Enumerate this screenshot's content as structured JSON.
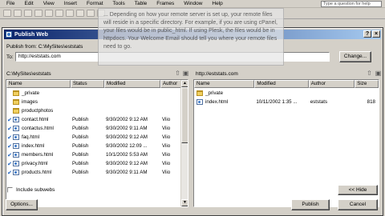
{
  "app": {
    "menu": [
      "File",
      "Edit",
      "View",
      "Insert",
      "Format",
      "Tools",
      "Table",
      "Frames",
      "Window",
      "Help"
    ],
    "help_placeholder": "Type a question for help"
  },
  "dialog": {
    "title": "Publish Web",
    "publish_from_label": "Publish from: C:\\MySites\\eststats",
    "to_label": "To:",
    "destination": "http://eststats.com",
    "change_button": "Change...",
    "local_path": "C:\\MySites\\eststats",
    "remote_path": "http://eststats.com",
    "local_columns": [
      "Name",
      "Status",
      "Modified",
      "Author"
    ],
    "remote_columns": [
      "Name",
      "Modified",
      "Author",
      "Size"
    ],
    "local_files": [
      {
        "name": "_private",
        "type": "folder",
        "checked": false,
        "status": "",
        "modified": "",
        "author": ""
      },
      {
        "name": "images",
        "type": "folder",
        "checked": false,
        "status": "",
        "modified": "",
        "author": ""
      },
      {
        "name": "productphotos",
        "type": "folder",
        "checked": false,
        "status": "",
        "modified": "",
        "author": ""
      },
      {
        "name": "contact.html",
        "type": "file",
        "checked": true,
        "status": "Publish",
        "modified": "9/30/2002 9:12 AM",
        "author": "Viio"
      },
      {
        "name": "contactus.html",
        "type": "file",
        "checked": true,
        "status": "Publish",
        "modified": "9/30/2002 9:11 AM",
        "author": "Viio"
      },
      {
        "name": "faq.html",
        "type": "file",
        "checked": true,
        "status": "Publish",
        "modified": "9/30/2002 9:12 AM",
        "author": "Viio"
      },
      {
        "name": "index.html",
        "type": "file",
        "checked": true,
        "status": "Publish",
        "modified": "9/30/2002 12:09 ...",
        "author": "Viio"
      },
      {
        "name": "members.html",
        "type": "file",
        "checked": true,
        "status": "Publish",
        "modified": "10/1/2002 5:53 AM",
        "author": "Viio"
      },
      {
        "name": "privacy.html",
        "type": "file",
        "checked": true,
        "status": "Publish",
        "modified": "9/30/2002 9:12 AM",
        "author": "Viio"
      },
      {
        "name": "products.html",
        "type": "file",
        "checked": true,
        "status": "Publish",
        "modified": "9/30/2002 9:11 AM",
        "author": "Viio"
      }
    ],
    "remote_files": [
      {
        "name": "_private",
        "type": "folder",
        "modified": "",
        "author": "",
        "size": ""
      },
      {
        "name": "index.html",
        "type": "file",
        "modified": "10/11/2002 1:35 ...",
        "author": "eststats",
        "size": "818"
      }
    ],
    "include_subwebs_label": "Include subwebs",
    "hide_button": "<< Hide",
    "options_button": "Options...",
    "publish_button": "Publish",
    "cancel_button": "Cancel"
  },
  "overlay_note": "... Depending on how your remote server is set up, your remote files will reside in a specific directory. For example, if you are using cPanel, your files would be in public_html. If using Plesk, the files would be in httpdocs. Your Welcome Email should tell you where your remote files need to go."
}
